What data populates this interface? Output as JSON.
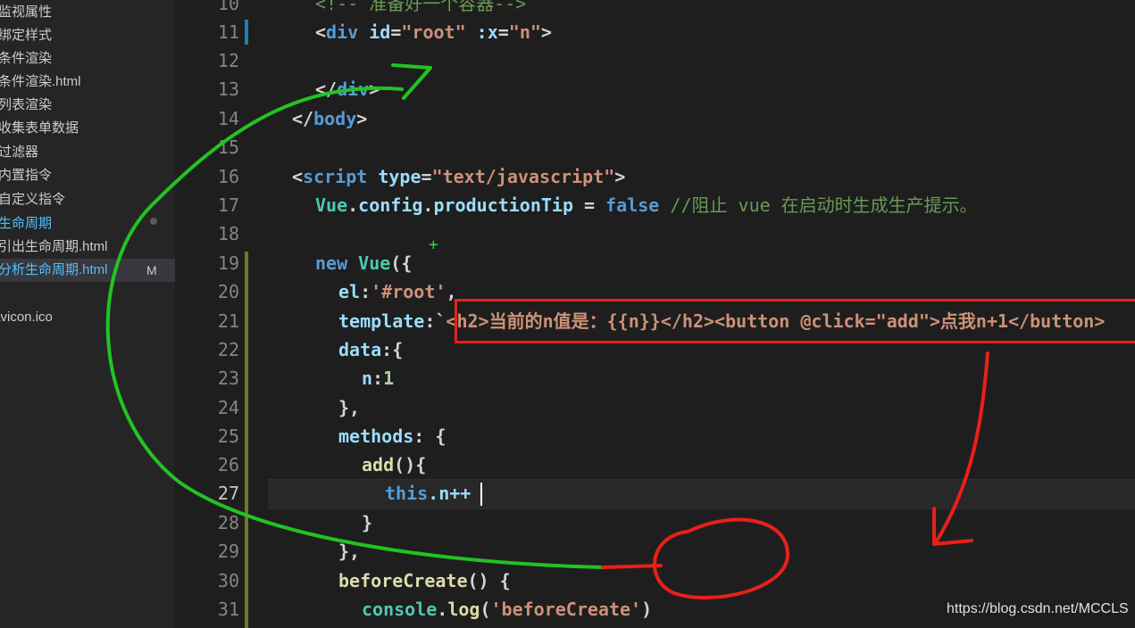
{
  "sidebar": {
    "items": [
      {
        "label": "监视属性"
      },
      {
        "label": "绑定样式"
      },
      {
        "label": "条件渲染"
      },
      {
        "label": "条件渲染.html"
      },
      {
        "label": "列表渲染"
      },
      {
        "label": "收集表单数据"
      },
      {
        "label": "过滤器"
      },
      {
        "label": "内置指令"
      },
      {
        "label": "自定义指令"
      },
      {
        "label": "生命周期"
      },
      {
        "label": "引出生命周期.html"
      },
      {
        "label": "分析生命周期.html",
        "badge": "M"
      },
      {
        "label": ""
      },
      {
        "label": "favicon.ico"
      }
    ]
  },
  "editor": {
    "line_numbers": [
      "10",
      "11",
      "12",
      "13",
      "14",
      "15",
      "16",
      "17",
      "18",
      "19",
      "20",
      "21",
      "22",
      "23",
      "24",
      "25",
      "26",
      "27",
      "28",
      "29",
      "30",
      "31"
    ],
    "current_line": "27",
    "lines": {
      "l10_comment": "<!-- 准备好一个容器-->",
      "l11_open": "<",
      "l11_tag": "div",
      "l11_attr1": "id",
      "l11_eq1": "=",
      "l11_val1": "\"root\"",
      "l11_attr2": ":x",
      "l11_eq2": "=",
      "l11_val2": "\"n\"",
      "l11_close": ">",
      "l13_open": "</",
      "l13_tag": "div",
      "l13_close": ">",
      "l14_open": "</",
      "l14_tag": "body",
      "l14_close": ">",
      "l16_open": "<",
      "l16_tag": "script",
      "l16_attr": "type",
      "l16_eq": "=",
      "l16_val": "\"text/javascript\"",
      "l16_close": ">",
      "l17_obj": "Vue",
      "l17_dot1": ".",
      "l17_prop1": "config",
      "l17_dot2": ".",
      "l17_prop2": "productionTip",
      "l17_eq": " = ",
      "l17_val": "false",
      "l17_comment": " //阻止 vue 在启动时生成生产提示。",
      "l19_kw": "new",
      "l19_cls": "Vue",
      "l19_rest": "({",
      "l20_key": "el",
      "l20_colon": ":",
      "l20_val": "'#root'",
      "l20_comma": ",",
      "l21_key": "template",
      "l21_colon": ":`",
      "l21_val": "<h2>当前的n值是：{{n}}</h2><button @click=\"add\">点我n+1</button>",
      "l22_key": "data",
      "l22_rest": ":{",
      "l23_key": "n",
      "l23_colon": ":",
      "l23_val": "1",
      "l24": "},",
      "l25_key": "methods",
      "l25_rest": ": {",
      "l26_fn": "add",
      "l26_rest": "(){",
      "l27_this": "this",
      "l27_rest": ".n++",
      "l28": "}",
      "l29": "},",
      "l30_fn": "beforeCreate",
      "l30_rest": "() {",
      "l31_obj": "console",
      "l31_dot": ".",
      "l31_fn": "log",
      "l31_p1": "(",
      "l31_str": "'beforeCreate'",
      "l31_p2": ")"
    }
  },
  "annotations": {
    "plus_sign": "+",
    "green_color": "#22c322",
    "red_color": "#e8201a"
  },
  "watermark": "https://blog.csdn.net/MCCLS"
}
